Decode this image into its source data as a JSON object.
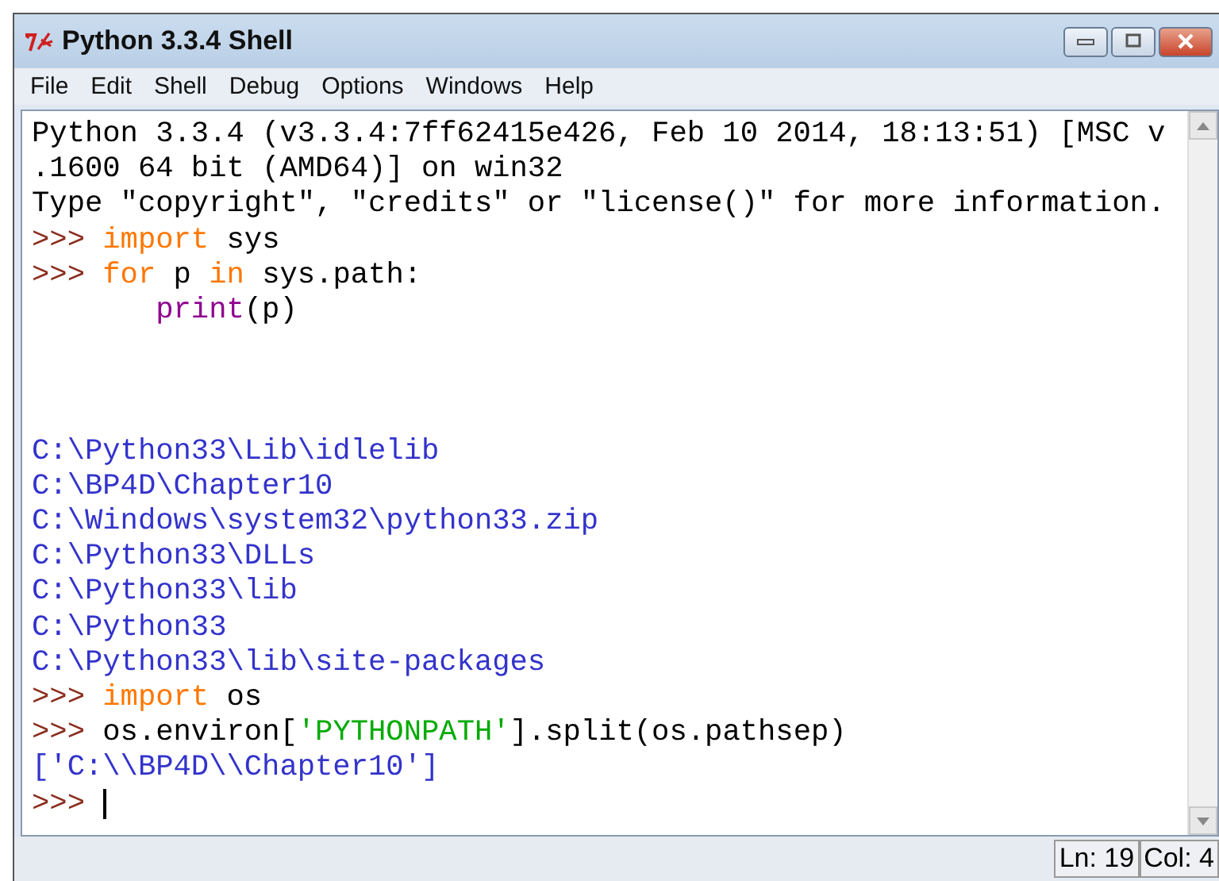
{
  "window": {
    "title": "Python 3.3.4 Shell"
  },
  "menu": [
    "File",
    "Edit",
    "Shell",
    "Debug",
    "Options",
    "Windows",
    "Help"
  ],
  "lines": [
    {
      "kind": "text",
      "segments": [
        {
          "kind": "plain",
          "text": "Python 3.3.4 (v3.3.4:7ff62415e426, Feb 10 2014, 18:13:51) [MSC v"
        }
      ]
    },
    {
      "kind": "text",
      "segments": [
        {
          "kind": "plain",
          "text": ".1600 64 bit (AMD64)] on win32"
        }
      ]
    },
    {
      "kind": "text",
      "segments": [
        {
          "kind": "plain",
          "text": "Type \"copyright\", \"credits\" or \"license()\" for more information."
        }
      ]
    },
    {
      "kind": "text",
      "segments": [
        {
          "kind": "prompt",
          "text": ">>>"
        },
        {
          "kind": "keyword",
          "text": "import"
        },
        {
          "kind": "plain",
          "text": "sys"
        }
      ]
    },
    {
      "kind": "text",
      "segments": [
        {
          "kind": "prompt",
          "text": ">>>"
        },
        {
          "kind": "keyword",
          "text": "for"
        },
        {
          "kind": "plain",
          "text": "p"
        },
        {
          "kind": "keyword",
          "text": "in"
        },
        {
          "kind": "plain",
          "text": "sys.path:"
        }
      ]
    },
    {
      "kind": "text",
      "indent": true,
      "segments": [
        {
          "kind": "builtin",
          "text": "print"
        },
        {
          "kind": "plain",
          "text": "(p)",
          "joined": true
        }
      ]
    },
    {
      "kind": "blank"
    },
    {
      "kind": "blank"
    },
    {
      "kind": "blank"
    },
    {
      "kind": "text",
      "segments": [
        {
          "kind": "stdout",
          "text": "C:\\Python33\\Lib\\idlelib"
        }
      ]
    },
    {
      "kind": "text",
      "segments": [
        {
          "kind": "stdout",
          "text": "C:\\BP4D\\Chapter10"
        }
      ]
    },
    {
      "kind": "text",
      "segments": [
        {
          "kind": "stdout",
          "text": "C:\\Windows\\system32\\python33.zip"
        }
      ]
    },
    {
      "kind": "text",
      "segments": [
        {
          "kind": "stdout",
          "text": "C:\\Python33\\DLLs"
        }
      ]
    },
    {
      "kind": "text",
      "segments": [
        {
          "kind": "stdout",
          "text": "C:\\Python33\\lib"
        }
      ]
    },
    {
      "kind": "text",
      "segments": [
        {
          "kind": "stdout",
          "text": "C:\\Python33"
        }
      ]
    },
    {
      "kind": "text",
      "segments": [
        {
          "kind": "stdout",
          "text": "C:\\Python33\\lib\\site-packages"
        }
      ]
    },
    {
      "kind": "text",
      "segments": [
        {
          "kind": "prompt",
          "text": ">>>"
        },
        {
          "kind": "keyword",
          "text": "import"
        },
        {
          "kind": "plain",
          "text": "os"
        }
      ]
    },
    {
      "kind": "text",
      "segments": [
        {
          "kind": "prompt",
          "text": ">>>"
        },
        {
          "kind": "plain",
          "text": "os.environ["
        },
        {
          "kind": "string",
          "text": "'PYTHONPATH'",
          "joined": true
        },
        {
          "kind": "plain",
          "text": "].split(os.pathsep)",
          "joined": true
        }
      ]
    },
    {
      "kind": "text",
      "segments": [
        {
          "kind": "stdout",
          "text": "['C:\\\\BP4D\\\\Chapter10']"
        }
      ]
    },
    {
      "kind": "text",
      "segments": [
        {
          "kind": "prompt",
          "text": ">>>"
        }
      ]
    }
  ],
  "input": {
    "cursor": true
  },
  "status_bar": {
    "line": "Ln: 19",
    "column": "Col: 4"
  }
}
